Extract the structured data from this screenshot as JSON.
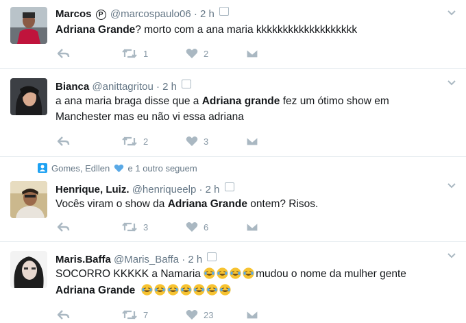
{
  "tweets": [
    {
      "name": "Marcos",
      "handle": "@marcospaulo06",
      "time": "2 h",
      "badge": "P",
      "text_bold_1": "Adriana Grande",
      "text_1": "? morto com a ana maria kkkkkkkkkkkkkkkkkkk",
      "retweets": "1",
      "likes": "2"
    },
    {
      "name": "Bianca",
      "handle": "@anittagritou",
      "time": "2 h",
      "text_pre": "a ana maria braga disse que a ",
      "text_bold_1": "Adriana grande",
      "text_post": " fez um ótimo show em",
      "text_line2": "Manchester mas eu não vi essa adriana",
      "retweets": "2",
      "likes": "3"
    },
    {
      "social_context": "Gomes, Edllen",
      "social_suffix": "e 1 outro seguem",
      "name": "Henrique, Luiz.",
      "handle": "@henriqueelp",
      "time": "2 h",
      "text_pre": "Vocês viram o show da ",
      "text_bold_1": "Adriana Grande",
      "text_post": " ontem? Risos.",
      "retweets": "3",
      "likes": "6"
    },
    {
      "name": "Maris.Baffa",
      "handle": "@Maris_Baffa",
      "time": "2 h",
      "text_pre": "SOCORRO KKKKK a Namaria ",
      "text_post": "mudou o nome da mulher gente",
      "text_bold_1": "Adriana Grande",
      "retweets": "7",
      "likes": "23"
    }
  ],
  "icons": [
    "reply-icon",
    "retweet-icon",
    "heart-icon",
    "direct-message-icon",
    "chevron-down-icon",
    "share-icon"
  ],
  "colors": {
    "icon_gray": "#aab8c2",
    "secondary_text": "#657786",
    "divider": "#e1e8ed",
    "heart_blue": "#5aa9e6"
  }
}
